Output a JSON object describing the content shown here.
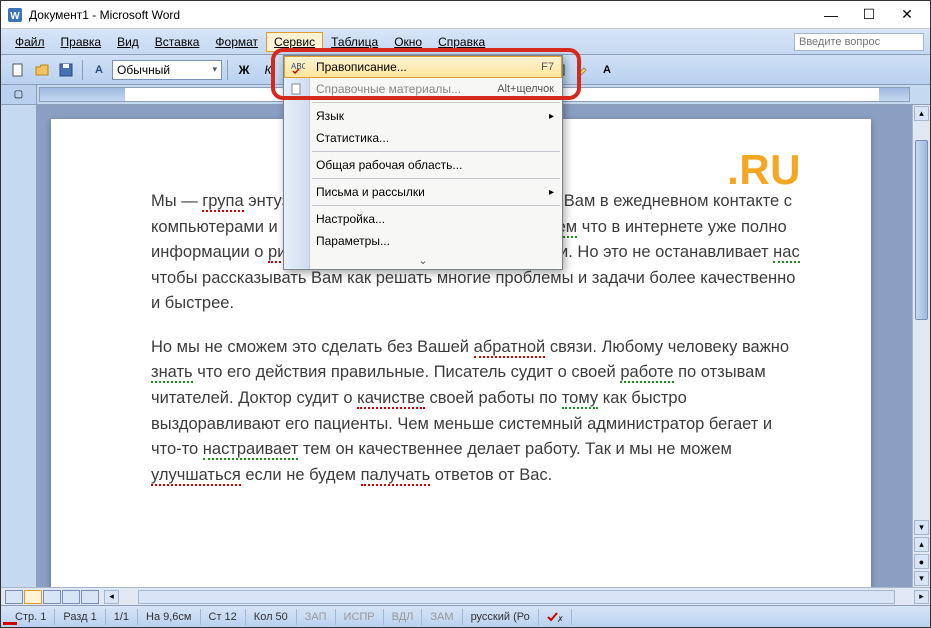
{
  "window": {
    "title": "Документ1 - Microsoft Word"
  },
  "menubar": {
    "file": "Файл",
    "edit": "Правка",
    "view": "Вид",
    "insert": "Вставка",
    "format": "Формат",
    "service": "Сервис",
    "table": "Таблица",
    "window_m": "Окно",
    "help": "Справка",
    "question_placeholder": "Введите вопрос"
  },
  "toolbar": {
    "style": "Обычный"
  },
  "dropdown": {
    "items": [
      {
        "label": "Правописание...",
        "shortcut": "F7"
      },
      {
        "label": "Справочные материалы...",
        "shortcut": "Alt+щелчок"
      },
      {
        "label": "Язык"
      },
      {
        "label": "Статистика..."
      },
      {
        "label": "Общая рабочая область..."
      },
      {
        "label": "Письма и рассылки"
      },
      {
        "label": "Настройка..."
      },
      {
        "label": "Параметры..."
      }
    ]
  },
  "document": {
    "logo": ".RU",
    "p1_a": "Мы — ",
    "p1_err1": "група",
    "p1_b": " энтузиастов одержимых идеей помогать Вам в ежедневном контакте с компьютерами и мобильными устройствами. Мы ",
    "p1_err2": "знаем",
    "p1_c": " что в интернете уже полно информации о ",
    "p1_err3": "ришении",
    "p1_d": " разного рода проблем с ними. Но это не останавливает ",
    "p1_err4": "нас",
    "p1_e": " чтобы рассказывать Вам как решать многие проблемы и задачи более качественно и быстрее.",
    "p2_a": "Но мы не сможем это сделать без Вашей ",
    "p2_err1": "абратной",
    "p2_b": " связи. Любому человеку важно ",
    "p2_err2": "знать",
    "p2_c": " что его действия правильные. Писатель судит о своей ",
    "p2_err3": "работе",
    "p2_d": " по отзывам читателей. Доктор судит о ",
    "p2_err4": "качистве",
    "p2_e": " своей работы по ",
    "p2_err5": "тому",
    "p2_f": " как быстро выздоравливают его пациенты. Чем меньше системный администратор бегает и что-то ",
    "p2_err6": "настраивает",
    "p2_g": " тем он качественнее делает работу. Так и мы не можем ",
    "p2_err7": "улучшаться",
    "p2_h": " если не будем ",
    "p2_err8": "палучать",
    "p2_i": " ответов от Вас."
  },
  "statusbar": {
    "page": "Стр. 1",
    "section": "Разд 1",
    "pages": "1/1",
    "at": "На 9,6см",
    "line": "Ст 12",
    "col": "Кол 50",
    "rec": "ЗАП",
    "fix": "ИСПР",
    "ext": "ВДЛ",
    "ovr": "ЗАМ",
    "lang": "русский (Ро"
  }
}
